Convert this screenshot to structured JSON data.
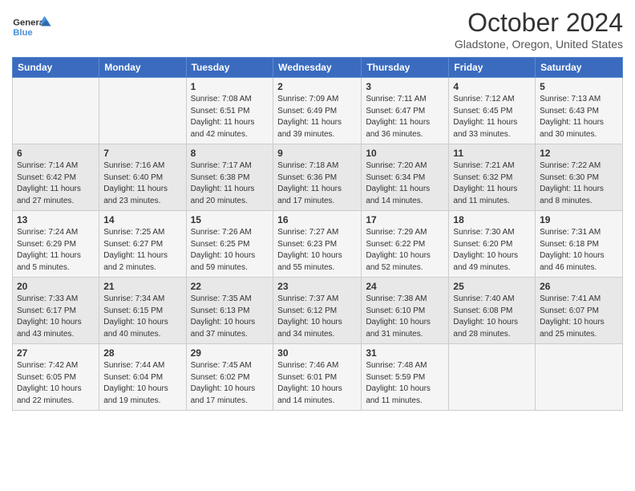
{
  "header": {
    "logo_general": "General",
    "logo_blue": "Blue",
    "month": "October 2024",
    "location": "Gladstone, Oregon, United States"
  },
  "weekdays": [
    "Sunday",
    "Monday",
    "Tuesday",
    "Wednesday",
    "Thursday",
    "Friday",
    "Saturday"
  ],
  "weeks": [
    [
      {
        "day": "",
        "info": ""
      },
      {
        "day": "",
        "info": ""
      },
      {
        "day": "1",
        "info": "Sunrise: 7:08 AM\nSunset: 6:51 PM\nDaylight: 11 hours and 42 minutes."
      },
      {
        "day": "2",
        "info": "Sunrise: 7:09 AM\nSunset: 6:49 PM\nDaylight: 11 hours and 39 minutes."
      },
      {
        "day": "3",
        "info": "Sunrise: 7:11 AM\nSunset: 6:47 PM\nDaylight: 11 hours and 36 minutes."
      },
      {
        "day": "4",
        "info": "Sunrise: 7:12 AM\nSunset: 6:45 PM\nDaylight: 11 hours and 33 minutes."
      },
      {
        "day": "5",
        "info": "Sunrise: 7:13 AM\nSunset: 6:43 PM\nDaylight: 11 hours and 30 minutes."
      }
    ],
    [
      {
        "day": "6",
        "info": "Sunrise: 7:14 AM\nSunset: 6:42 PM\nDaylight: 11 hours and 27 minutes."
      },
      {
        "day": "7",
        "info": "Sunrise: 7:16 AM\nSunset: 6:40 PM\nDaylight: 11 hours and 23 minutes."
      },
      {
        "day": "8",
        "info": "Sunrise: 7:17 AM\nSunset: 6:38 PM\nDaylight: 11 hours and 20 minutes."
      },
      {
        "day": "9",
        "info": "Sunrise: 7:18 AM\nSunset: 6:36 PM\nDaylight: 11 hours and 17 minutes."
      },
      {
        "day": "10",
        "info": "Sunrise: 7:20 AM\nSunset: 6:34 PM\nDaylight: 11 hours and 14 minutes."
      },
      {
        "day": "11",
        "info": "Sunrise: 7:21 AM\nSunset: 6:32 PM\nDaylight: 11 hours and 11 minutes."
      },
      {
        "day": "12",
        "info": "Sunrise: 7:22 AM\nSunset: 6:30 PM\nDaylight: 11 hours and 8 minutes."
      }
    ],
    [
      {
        "day": "13",
        "info": "Sunrise: 7:24 AM\nSunset: 6:29 PM\nDaylight: 11 hours and 5 minutes."
      },
      {
        "day": "14",
        "info": "Sunrise: 7:25 AM\nSunset: 6:27 PM\nDaylight: 11 hours and 2 minutes."
      },
      {
        "day": "15",
        "info": "Sunrise: 7:26 AM\nSunset: 6:25 PM\nDaylight: 10 hours and 59 minutes."
      },
      {
        "day": "16",
        "info": "Sunrise: 7:27 AM\nSunset: 6:23 PM\nDaylight: 10 hours and 55 minutes."
      },
      {
        "day": "17",
        "info": "Sunrise: 7:29 AM\nSunset: 6:22 PM\nDaylight: 10 hours and 52 minutes."
      },
      {
        "day": "18",
        "info": "Sunrise: 7:30 AM\nSunset: 6:20 PM\nDaylight: 10 hours and 49 minutes."
      },
      {
        "day": "19",
        "info": "Sunrise: 7:31 AM\nSunset: 6:18 PM\nDaylight: 10 hours and 46 minutes."
      }
    ],
    [
      {
        "day": "20",
        "info": "Sunrise: 7:33 AM\nSunset: 6:17 PM\nDaylight: 10 hours and 43 minutes."
      },
      {
        "day": "21",
        "info": "Sunrise: 7:34 AM\nSunset: 6:15 PM\nDaylight: 10 hours and 40 minutes."
      },
      {
        "day": "22",
        "info": "Sunrise: 7:35 AM\nSunset: 6:13 PM\nDaylight: 10 hours and 37 minutes."
      },
      {
        "day": "23",
        "info": "Sunrise: 7:37 AM\nSunset: 6:12 PM\nDaylight: 10 hours and 34 minutes."
      },
      {
        "day": "24",
        "info": "Sunrise: 7:38 AM\nSunset: 6:10 PM\nDaylight: 10 hours and 31 minutes."
      },
      {
        "day": "25",
        "info": "Sunrise: 7:40 AM\nSunset: 6:08 PM\nDaylight: 10 hours and 28 minutes."
      },
      {
        "day": "26",
        "info": "Sunrise: 7:41 AM\nSunset: 6:07 PM\nDaylight: 10 hours and 25 minutes."
      }
    ],
    [
      {
        "day": "27",
        "info": "Sunrise: 7:42 AM\nSunset: 6:05 PM\nDaylight: 10 hours and 22 minutes."
      },
      {
        "day": "28",
        "info": "Sunrise: 7:44 AM\nSunset: 6:04 PM\nDaylight: 10 hours and 19 minutes."
      },
      {
        "day": "29",
        "info": "Sunrise: 7:45 AM\nSunset: 6:02 PM\nDaylight: 10 hours and 17 minutes."
      },
      {
        "day": "30",
        "info": "Sunrise: 7:46 AM\nSunset: 6:01 PM\nDaylight: 10 hours and 14 minutes."
      },
      {
        "day": "31",
        "info": "Sunrise: 7:48 AM\nSunset: 5:59 PM\nDaylight: 10 hours and 11 minutes."
      },
      {
        "day": "",
        "info": ""
      },
      {
        "day": "",
        "info": ""
      }
    ]
  ]
}
